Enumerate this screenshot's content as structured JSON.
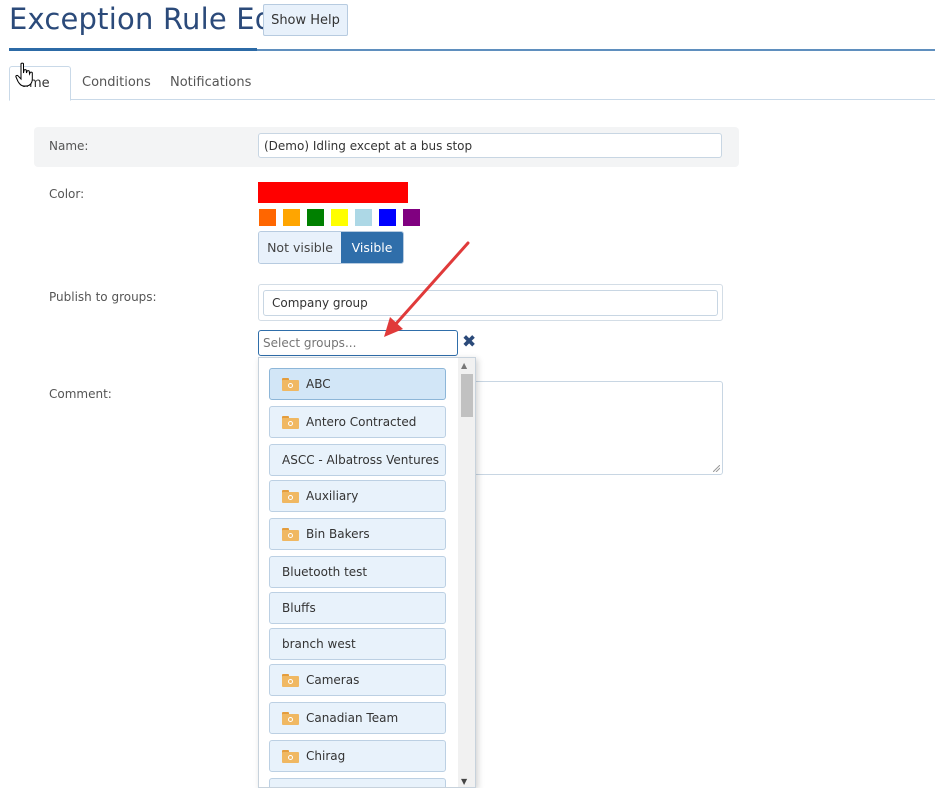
{
  "header": {
    "title": "Exception Rule Edit",
    "help_button": "Show Help"
  },
  "tabs": [
    {
      "label": "Name",
      "visible_text": "ame",
      "active": true
    },
    {
      "label": "Conditions",
      "active": false
    },
    {
      "label": "Notifications",
      "active": false
    }
  ],
  "form": {
    "name_label": "Name:",
    "name_value": "(Demo) Idling except at a bus stop",
    "color_label": "Color:",
    "selected_color": "#ff0000",
    "swatches": [
      "#ff6600",
      "#ffa500",
      "#008000",
      "#ffff00",
      "#add8e6",
      "#0000ff",
      "#800080"
    ],
    "visibility": {
      "not_visible": "Not visible",
      "visible": "Visible",
      "selected": "Visible"
    },
    "publish_label": "Publish to groups:",
    "published_group": "Company group",
    "select_placeholder": "Select groups...",
    "comment_label": "Comment:"
  },
  "dropdown": {
    "options": [
      {
        "label": "ABC",
        "folder": true,
        "selected": true
      },
      {
        "label": "Antero Contracted",
        "folder": true
      },
      {
        "label": "ASCC - Albatross Ventures",
        "folder": false
      },
      {
        "label": "Auxiliary",
        "folder": true
      },
      {
        "label": "Bin Bakers",
        "folder": true
      },
      {
        "label": "Bluetooth test",
        "folder": false
      },
      {
        "label": "Bluffs",
        "folder": false
      },
      {
        "label": "branch west",
        "folder": false
      },
      {
        "label": "Cameras",
        "folder": true
      },
      {
        "label": "Canadian Team",
        "folder": true
      },
      {
        "label": "Chirag",
        "folder": true
      }
    ]
  },
  "colors": {
    "accent": "#2f6eaa",
    "title": "#2b4a7a",
    "annotation_arrow": "#e03a3a"
  }
}
